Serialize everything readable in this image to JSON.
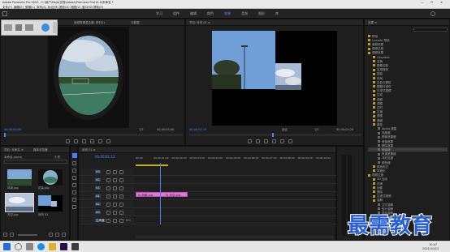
{
  "app": {
    "title": "Adobe Premiere Pro 2020 - C:\\用户\\Dbjq\\文档\\Adobe\\Premiere Pro\\14.0\\未命名 *",
    "window_buttons": [
      "—",
      "☐",
      "✕"
    ]
  },
  "menu": [
    "文件(F)",
    "编辑(E)",
    "剪辑(C)",
    "序列(S)",
    "标记(M)",
    "图形(G)",
    "视图(V)",
    "窗口(W)",
    "帮助(H)"
  ],
  "workspaces": [
    "学习",
    "组件",
    "编辑",
    "颜色",
    "效果",
    "音频",
    "图形",
    "库"
  ],
  "active_workspace": "效果",
  "source_monitor": {
    "tabs": [
      "源: (无剪辑)",
      "效果控件",
      "音频剪辑混合器: 序列01",
      "元数据"
    ],
    "timecode_left": "00;00;00;00",
    "timecode_right": "00;00;05;00",
    "scale": "1/2"
  },
  "program_monitor": {
    "tab": "节目: 序列 01 ≡",
    "timecode_left": "00;00;01;13",
    "timecode_right": "00;00;04;20",
    "fit": "适合",
    "scale": "1/2"
  },
  "effects_panel": {
    "title": "效果 ≡",
    "items": [
      "预设",
      "Lumetri 预设",
      "音频效果",
      "音频过渡",
      "视频效果",
      "Obsolete",
      "变换",
      "图像控制",
      "实用程序",
      "扭曲",
      "时间",
      "杂色与颗粒",
      "模糊与锐化",
      "沉浸式视频",
      "生成",
      "视频",
      "调整",
      "过时",
      "过渡",
      "透视",
      "通道",
      "键控",
      "Alpha 调整",
      "亮度键",
      "图像遮罩键",
      "差值遮罩",
      "移除遮罩",
      "超级键",
      "轨道遮罩键",
      "非红色键",
      "颜色键",
      "颜色校正",
      "风格化",
      "视频过渡",
      "3D 运动",
      "内滑",
      "划像",
      "擦除",
      "沉浸式视频",
      "溶解",
      "交叉溶解",
      "胶片溶解",
      "叠加溶解",
      "非叠加溶解",
      "黑场过渡",
      "白场过渡",
      "页面剥落",
      "缩放"
    ]
  },
  "project_panel": {
    "tabs": [
      "项目: 未命名 ≡",
      "媒体浏览器"
    ],
    "filename": "未命名.prproj",
    "count": "3 项",
    "items": [
      {
        "name": "风景.jpg",
        "duration": "5:00"
      },
      {
        "name": "花朵.jpg",
        "duration": "5:00"
      },
      {
        "name": "天空.jpg",
        "duration": "5:00"
      },
      {
        "name": "序列 01",
        "duration": "5:00"
      }
    ]
  },
  "timeline": {
    "tab": "序列 01 ≡",
    "timecode": "00;00;01;13",
    "ruler": [
      "00;00",
      "00;00;01;00",
      "00;00;02;00",
      "00;00;03;00",
      "00;00;04;00",
      "00;00;05;00",
      "00;00;06;00",
      "00;00;07;00",
      "00;00;08;00",
      "00;00;09;00",
      "00;00;10;00"
    ],
    "tracks": [
      "V3",
      "V2",
      "V1",
      "A1",
      "A2",
      "A3",
      "主声道"
    ],
    "master_value": "0.0",
    "clips": [
      {
        "label": "fx 风景.jpg",
        "track": "V2"
      },
      {
        "label": "fx 天空.jpg",
        "track": "V2"
      }
    ],
    "clip_color": "#e07ad6",
    "playhead_color": "#4d7cff"
  },
  "watermark": "最需教育",
  "clock": {
    "time": "10:47",
    "date": "2021/10/15"
  }
}
